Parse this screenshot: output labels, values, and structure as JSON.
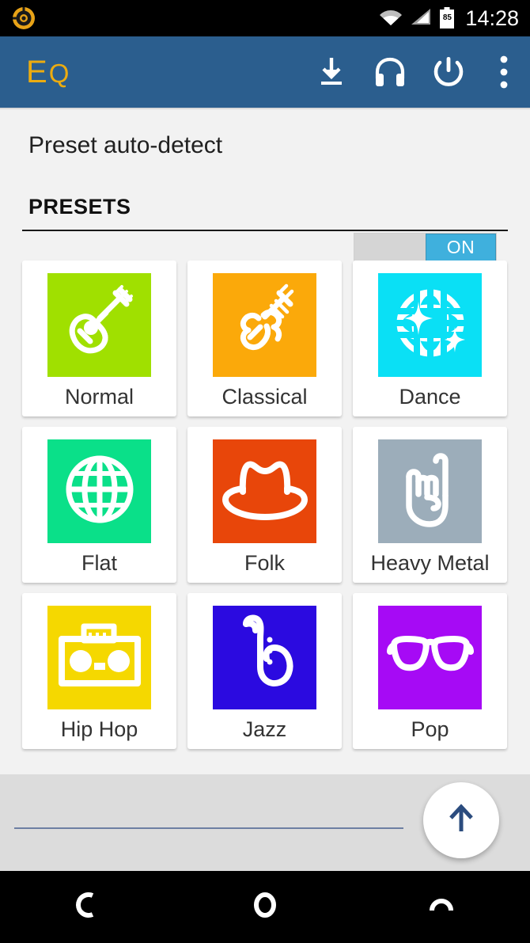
{
  "status_bar": {
    "clock": "14:28",
    "battery_level": "85",
    "icons": [
      "app-notification-icon",
      "wifi-icon",
      "cellular-signal-icon",
      "battery-icon"
    ]
  },
  "app_bar": {
    "logo_primary": "E",
    "logo_secondary": "Q",
    "logo_color": "#ecac10",
    "background_color": "#2b5e8e",
    "actions": [
      {
        "name": "download-icon",
        "label": "Download"
      },
      {
        "name": "headphones-icon",
        "label": "Headphones"
      },
      {
        "name": "power-icon",
        "label": "Power"
      },
      {
        "name": "overflow-menu-icon",
        "label": "More options"
      }
    ]
  },
  "auto_detect": {
    "label": "Preset auto-detect",
    "state_label": "ON",
    "enabled": true,
    "accent_color": "#3fb0dd"
  },
  "presets_section": {
    "header": "PRESETS",
    "items": [
      {
        "label": "Normal",
        "icon": "guitar-icon",
        "color": "#a0e000"
      },
      {
        "label": "Classical",
        "icon": "violin-icon",
        "color": "#fba90a"
      },
      {
        "label": "Dance",
        "icon": "sparkle-globe-icon",
        "color": "#0ae0f5"
      },
      {
        "label": "Flat",
        "icon": "globe-icon",
        "color": "#0ae089"
      },
      {
        "label": "Folk",
        "icon": "cowboy-hat-icon",
        "color": "#e8460a"
      },
      {
        "label": "Heavy Metal",
        "icon": "rock-hand-icon",
        "color": "#9cadba"
      },
      {
        "label": "Hip Hop",
        "icon": "boombox-icon",
        "color": "#f5d800"
      },
      {
        "label": "Jazz",
        "icon": "saxophone-icon",
        "color": "#2b0ae0"
      },
      {
        "label": "Pop",
        "icon": "sunglasses-icon",
        "color": "#a60af5"
      }
    ]
  },
  "bottom_panel": {
    "fab_icon": "arrow-up-icon",
    "fab_arrow_color": "#2b4c7e",
    "divider_color": "#6d7fa3",
    "background_color": "#dcdcdc"
  },
  "nav_bar": {
    "buttons": [
      {
        "name": "back-nav-button",
        "icon": "back-arc-icon"
      },
      {
        "name": "home-nav-button",
        "icon": "home-circle-icon"
      },
      {
        "name": "recents-nav-button",
        "icon": "recents-arc-icon"
      }
    ]
  }
}
